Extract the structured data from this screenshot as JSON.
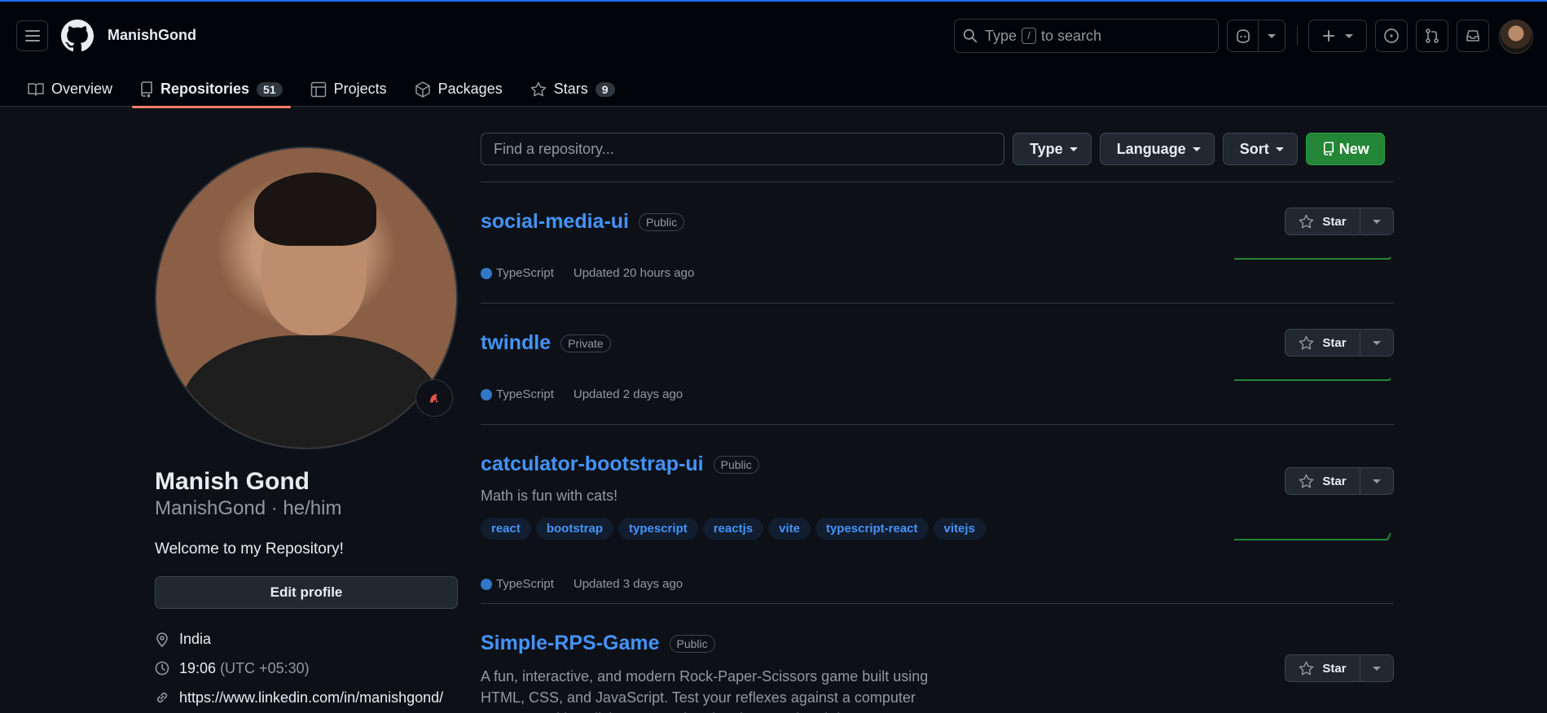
{
  "header": {
    "username": "ManishGond",
    "search_placeholder_before": "Type",
    "search_kbd": "/",
    "search_placeholder_after": "to search"
  },
  "tabs": [
    {
      "label": "Overview",
      "icon": "book-icon"
    },
    {
      "label": "Repositories",
      "icon": "repo-icon",
      "count": "51",
      "active": true
    },
    {
      "label": "Projects",
      "icon": "table-icon"
    },
    {
      "label": "Packages",
      "icon": "package-icon"
    },
    {
      "label": "Stars",
      "icon": "star-icon",
      "count": "9"
    }
  ],
  "profile": {
    "full_name": "Manish Gond",
    "handle": "ManishGond · he/him",
    "bio": "Welcome to my Repository!",
    "edit_label": "Edit profile",
    "location": "India",
    "local_time": "19:06",
    "timezone": "(UTC +05:30)",
    "link": "https://www.linkedin.com/in/manishgond/"
  },
  "filters": {
    "find_placeholder": "Find a repository...",
    "type_label": "Type",
    "language_label": "Language",
    "sort_label": "Sort",
    "new_label": "New"
  },
  "repos": [
    {
      "name": "social-media-ui",
      "visibility": "Public",
      "language": "TypeScript",
      "updated": "Updated 20 hours ago",
      "star_label": "Star"
    },
    {
      "name": "twindle",
      "visibility": "Private",
      "language": "TypeScript",
      "updated": "Updated 2 days ago",
      "star_label": "Star"
    },
    {
      "name": "catculator-bootstrap-ui",
      "visibility": "Public",
      "description": "Math is fun with cats!",
      "topics": [
        "react",
        "bootstrap",
        "typescript",
        "reactjs",
        "vite",
        "typescript-react",
        "vitejs"
      ],
      "language": "TypeScript",
      "updated": "Updated 3 days ago",
      "star_label": "Star"
    },
    {
      "name": "Simple-RPS-Game",
      "visibility": "Public",
      "description": "A fun, interactive, and modern Rock-Paper-Scissors game built using HTML, CSS, and JavaScript. Test your reflexes against a computer opponent with stylish UI, smooth animations, and real-time",
      "star_label": "Star"
    }
  ],
  "colors": {
    "background": "#0d1117",
    "header": "#010409",
    "link": "#4493f8",
    "accent_underline": "#f78166",
    "new_button": "#238636",
    "typescript": "#3178c6"
  }
}
